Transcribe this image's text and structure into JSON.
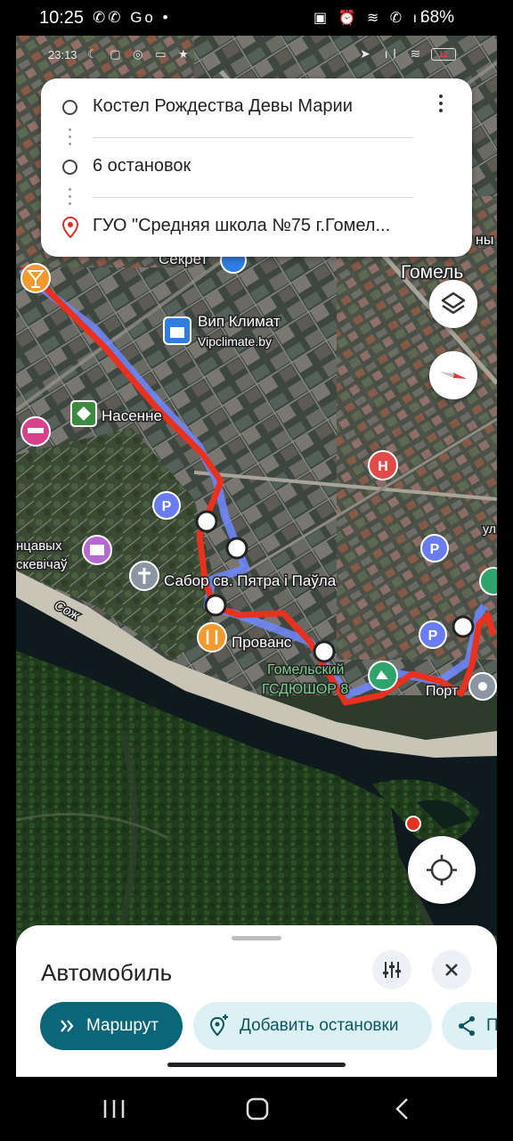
{
  "status_bar": {
    "time": "10:25",
    "left_icons": "✆✆ Go •",
    "right_icons": "▣ ⏰ ≋ ✆ ıl",
    "battery": "68%"
  },
  "inner_status": {
    "time": "23:13",
    "icons": "☾ ▢ ◎ ▭ ★",
    "right_icons": "➤ ıl ≋",
    "battery": "12"
  },
  "route": {
    "origin": "Костел Рождества Девы Марии",
    "stops": "6 остановок",
    "destination": "ГУО \"Средняя школа №75 г.Гомел..."
  },
  "map_labels": {
    "city": "Гомель",
    "sekret": "Секрет",
    "vip_klimat": "Вип Климат",
    "vipclimate": "Vipclimate.by",
    "nasenne": "Насенне",
    "sabor": "Сабор св. Пятра і Паўла",
    "provans": "Прованс",
    "gomelsky": "Гомельский",
    "gsdyushor": "ГСДЮШОР 8",
    "sozh": "Сож",
    "port": "Порт",
    "ntsavyh": "нцавых",
    "skevichau": "скевічаў",
    "ny": "ны",
    "ul": "ул"
  },
  "sheet": {
    "title": "Автомобиль",
    "route_button": "Маршрут",
    "add_stops_button": "Добавить остановки",
    "share_button": "П"
  },
  "colors": {
    "route_red": "#e8321f",
    "route_blue": "#6f88ff",
    "primary": "#0b6679",
    "chip_bg": "#dcf1f4"
  },
  "icons": {
    "layers": "layers-icon",
    "compass": "compass-icon",
    "locate": "my-location-icon",
    "tune": "tune-icon",
    "close": "close-icon",
    "share": "share-icon",
    "add_stop": "add-location-icon",
    "directions": "double-chevron-icon"
  }
}
